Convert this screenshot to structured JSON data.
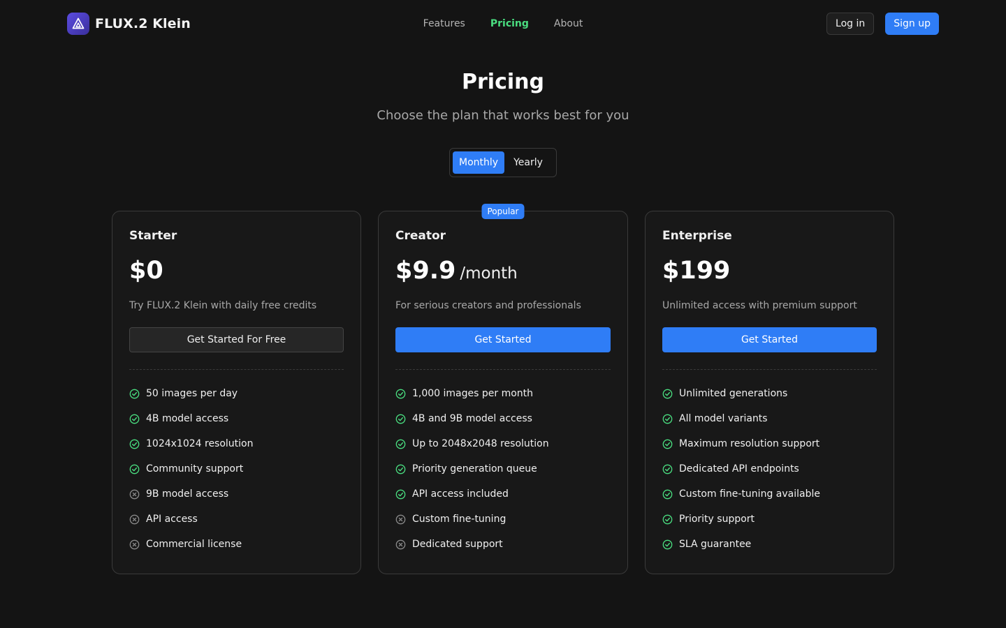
{
  "brand": {
    "name": "FLUX.2 Klein"
  },
  "nav": {
    "items": [
      {
        "label": "Features",
        "active": false
      },
      {
        "label": "Pricing",
        "active": true
      },
      {
        "label": "About",
        "active": false
      }
    ]
  },
  "auth": {
    "login_label": "Log in",
    "signup_label": "Sign up"
  },
  "hero": {
    "title": "Pricing",
    "subtitle": "Choose the plan that works best for you"
  },
  "billing_toggle": {
    "options": [
      "Monthly",
      "Yearly"
    ],
    "selected": "Monthly"
  },
  "colors": {
    "accent": "#2f7df6",
    "check": "#4ade80",
    "cross": "#8a8a8a",
    "background": "#141414"
  },
  "plans": [
    {
      "name": "Starter",
      "price": "$0",
      "period": "",
      "badge": "",
      "description": "Try FLUX.2 Klein with daily free credits",
      "cta_label": "Get Started For Free",
      "features": [
        {
          "label": "50 images per day",
          "included": true,
          "icon": "check-circle-icon"
        },
        {
          "label": "4B model access",
          "included": true,
          "icon": "check-circle-icon"
        },
        {
          "label": "1024x1024 resolution",
          "included": true,
          "icon": "check-circle-icon"
        },
        {
          "label": "Community support",
          "included": true,
          "icon": "check-circle-icon"
        },
        {
          "label": "9B model access",
          "included": false,
          "icon": "x-circle-icon"
        },
        {
          "label": "API access",
          "included": false,
          "icon": "x-circle-icon"
        },
        {
          "label": "Commercial license",
          "included": false,
          "icon": "x-circle-icon"
        }
      ]
    },
    {
      "name": "Creator",
      "price": "$9.9",
      "period": "/month",
      "badge": "Popular",
      "description": "For serious creators and professionals",
      "cta_label": "Get Started",
      "features": [
        {
          "label": "1,000 images per month",
          "included": true,
          "icon": "check-circle-icon"
        },
        {
          "label": "4B and 9B model access",
          "included": true,
          "icon": "check-circle-icon"
        },
        {
          "label": "Up to 2048x2048 resolution",
          "included": true,
          "icon": "check-circle-icon"
        },
        {
          "label": "Priority generation queue",
          "included": true,
          "icon": "check-circle-icon"
        },
        {
          "label": "API access included",
          "included": true,
          "icon": "check-circle-icon"
        },
        {
          "label": "Custom fine-tuning",
          "included": false,
          "icon": "x-circle-icon"
        },
        {
          "label": "Dedicated support",
          "included": false,
          "icon": "x-circle-icon"
        }
      ]
    },
    {
      "name": "Enterprise",
      "price": "$199",
      "period": "",
      "badge": "",
      "description": "Unlimited access with premium support",
      "cta_label": "Get Started",
      "features": [
        {
          "label": "Unlimited generations",
          "included": true,
          "icon": "check-circle-icon"
        },
        {
          "label": "All model variants",
          "included": true,
          "icon": "check-circle-icon"
        },
        {
          "label": "Maximum resolution support",
          "included": true,
          "icon": "check-circle-icon"
        },
        {
          "label": "Dedicated API endpoints",
          "included": true,
          "icon": "check-circle-icon"
        },
        {
          "label": "Custom fine-tuning available",
          "included": true,
          "icon": "check-circle-icon"
        },
        {
          "label": "Priority support",
          "included": true,
          "icon": "check-circle-icon"
        },
        {
          "label": "SLA guarantee",
          "included": true,
          "icon": "check-circle-icon"
        }
      ]
    }
  ]
}
